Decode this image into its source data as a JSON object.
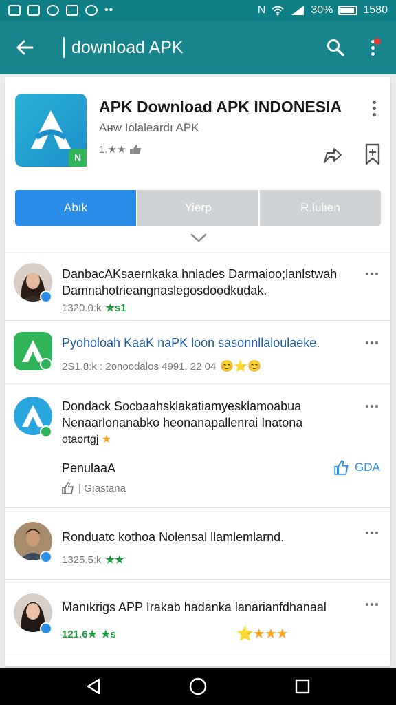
{
  "status_bar": {
    "battery": "30%",
    "time": "1580"
  },
  "app_bar": {
    "query": "download APK"
  },
  "app": {
    "title": "APK Download APK INDONESIA",
    "subtitle": "Aнw Iolaleardı APK",
    "rating": "1.★★",
    "logo_badge": "N",
    "tabs": [
      "Abık",
      "Yierp",
      "R.lulıen"
    ]
  },
  "feed": [
    {
      "title": "DanbacAKsaernkaka hnlades Darmaioo;lanlstwah",
      "line2": "Damnahotrieangnaslegosdoodkudak.",
      "meta": "1320.0:k",
      "stars": "★s1"
    },
    {
      "title": "Pyoholoah KaaK naPK loon sasonnllaloulaeke.",
      "meta": "2S1.8:k : 2onoodalos 4991. 22 04"
    },
    {
      "title": "Dondack Socbaahsklakatiamyesklamoabua",
      "line2": "Nenaarlonanabko heonanapallenrai Inatona",
      "line3": "otaortgj",
      "label": "PenulaaA",
      "gda": "GDA",
      "like_text": "| Gıastana"
    },
    {
      "title": "Ronduatc kothoa Nolensal llamlemlarnd.",
      "meta": "1325.5:k",
      "stars": "★★"
    },
    {
      "title": "Manıkrigs APP Irakab hadanka lanarianfdhanaal",
      "meta": "121.6★",
      "stars": "★s"
    }
  ],
  "colors": {
    "teal_status": "#0f7f86",
    "teal_appbar": "#17858b",
    "accent_blue": "#2a8ee8",
    "green": "#1a9c3e",
    "segment_gray": "#cfd2d4"
  }
}
